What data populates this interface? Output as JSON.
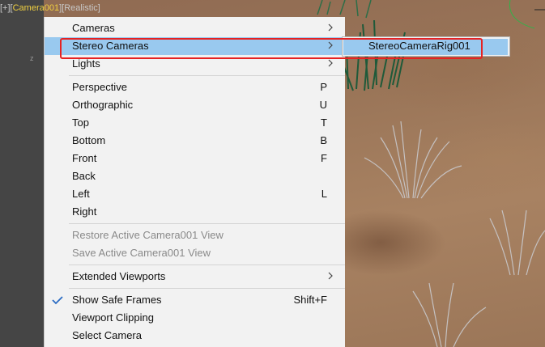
{
  "viewport": {
    "label_parts": [
      "[+]",
      "[",
      "Camera001",
      "]",
      "[",
      "Realistic",
      "]"
    ],
    "axis_label": "z"
  },
  "menu": {
    "items": [
      {
        "label": "Cameras",
        "submenu": true
      },
      {
        "label": "Stereo Cameras",
        "submenu": true,
        "highlighted": true
      },
      {
        "label": "Lights",
        "submenu": true
      },
      {
        "label": "Perspective",
        "shortcut": "P"
      },
      {
        "label": "Orthographic",
        "shortcut": "U"
      },
      {
        "label": "Top",
        "shortcut": "T"
      },
      {
        "label": "Bottom",
        "shortcut": "B"
      },
      {
        "label": "Front",
        "shortcut": "F"
      },
      {
        "label": "Back"
      },
      {
        "label": "Left",
        "shortcut": "L"
      },
      {
        "label": "Right"
      },
      {
        "label": "Restore Active Camera001 View",
        "disabled": true
      },
      {
        "label": "Save Active Camera001 View",
        "disabled": true
      },
      {
        "label": "Extended Viewports",
        "submenu": true
      },
      {
        "label": "Show Safe Frames",
        "shortcut": "Shift+F",
        "checked": true
      },
      {
        "label": "Viewport Clipping"
      },
      {
        "label": "Select Camera"
      }
    ]
  },
  "submenu": {
    "items": [
      {
        "label": "StereoCameraRig001",
        "highlighted": true
      }
    ]
  },
  "colors": {
    "highlight": "#99c9ef",
    "annotation": "#e62222",
    "camera_label": "#f0d040"
  }
}
